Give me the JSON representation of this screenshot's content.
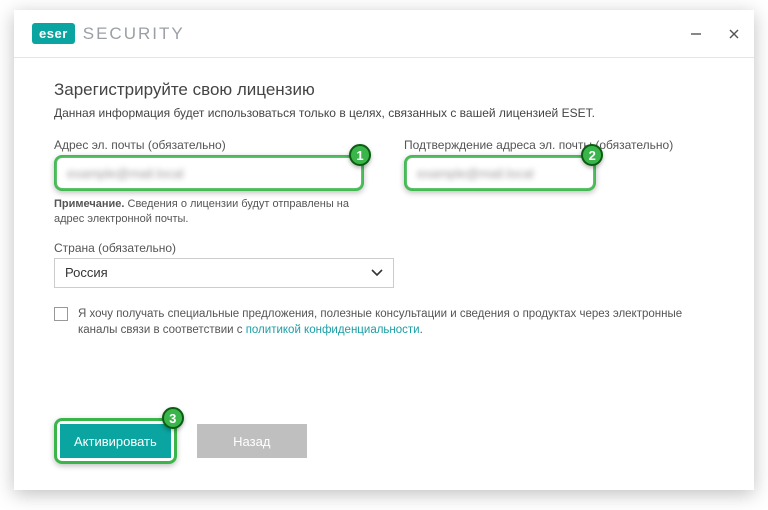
{
  "brand": {
    "badge": "eser",
    "product": "SECURITY"
  },
  "header": {
    "title": "Зарегистрируйте свою лицензию",
    "subtitle": "Данная информация будет использоваться только в целях, связанных с вашей лицензией ESET."
  },
  "fields": {
    "email": {
      "label": "Адрес эл. почты (обязательно)",
      "value": "example@mail.local"
    },
    "emailConfirm": {
      "label": "Подтверждение адреса эл. почты (обязательно)",
      "value": "example@mail.local"
    },
    "note_prefix": "Примечание.",
    "note_text": " Сведения о лицензии будут отправлены на адрес электронной почты.",
    "country": {
      "label": "Страна (обязательно)",
      "value": "Россия"
    }
  },
  "consent": {
    "text_before": "Я хочу получать специальные предложения, полезные консультации и сведения о продуктах через электронные каналы связи в соответствии с ",
    "link": "политикой конфиденциальности",
    "text_after": "."
  },
  "buttons": {
    "activate": "Активировать",
    "back": "Назад"
  },
  "steps": {
    "one": "1",
    "two": "2",
    "three": "3"
  }
}
